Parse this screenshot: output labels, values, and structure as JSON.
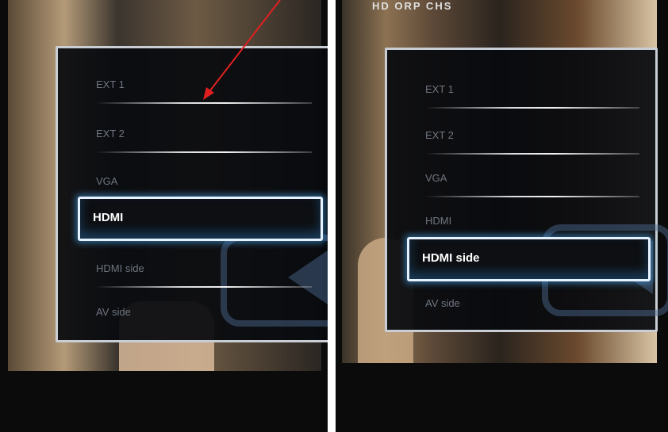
{
  "left_photo": {
    "menu_items": [
      {
        "label": "EXT 1",
        "selected": false
      },
      {
        "label": "EXT 2",
        "selected": false
      },
      {
        "label": "VGA",
        "selected": false
      },
      {
        "label": "HDMI",
        "selected": true
      },
      {
        "label": "HDMI side",
        "selected": false
      },
      {
        "label": "AV side",
        "selected": false
      }
    ]
  },
  "right_photo": {
    "osd_top": "HD ORP CHS",
    "menu_items": [
      {
        "label": "EXT 1",
        "selected": false
      },
      {
        "label": "EXT 2",
        "selected": false
      },
      {
        "label": "VGA",
        "selected": false
      },
      {
        "label": "HDMI",
        "selected": false
      },
      {
        "label": "HDMI side",
        "selected": true
      },
      {
        "label": "AV side",
        "selected": false
      }
    ]
  },
  "annotation": {
    "color": "#e02020",
    "icon": "arrow-icon"
  },
  "colors": {
    "selection_glow": "#46a0e6",
    "panel_border": "#c9ced4",
    "item_text": "#6f7680"
  }
}
